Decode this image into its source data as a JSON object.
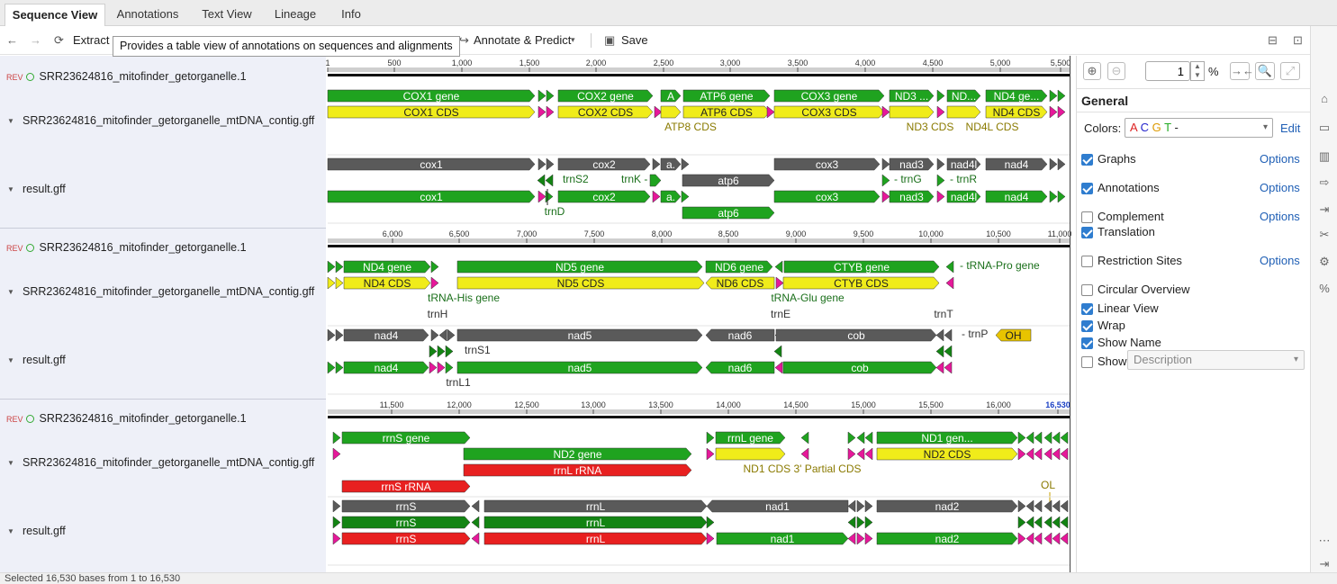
{
  "tabs": [
    "Sequence View",
    "Annotations",
    "Text View",
    "Lineage",
    "Info"
  ],
  "toolbar": {
    "extract": "Extract",
    "annotate": "Annotate & Predict",
    "save": "Save",
    "tooltip": "Provides a table view of annotations on sequences and alignments"
  },
  "rows": [
    {
      "seq": "SRR23624816_mitofinder_getorganelle.1",
      "gff": "SRR23624816_mitofinder_getorganelle_mtDNA_contig.gff",
      "result": "result.gff",
      "rev": "REV"
    },
    {
      "seq": "SRR23624816_mitofinder_getorganelle.1",
      "gff": "SRR23624816_mitofinder_getorganelle_mtDNA_contig.gff",
      "result": "result.gff",
      "rev": "REV"
    },
    {
      "seq": "SRR23624816_mitofinder_getorganelle.1",
      "gff": "SRR23624816_mitofinder_getorganelle_mtDNA_contig.gff",
      "result": "result.gff",
      "rev": "REV"
    }
  ],
  "ruler1": [
    "1",
    "500",
    "1,000",
    "1,500",
    "2,000",
    "2,500",
    "3,000",
    "3,500",
    "4,000",
    "4,500",
    "5,000",
    "5,500"
  ],
  "ruler2": [
    "6,000",
    "6,500",
    "7,000",
    "7,500",
    "8,000",
    "8,500",
    "9,000",
    "9,500",
    "10,000",
    "10,500",
    "11,000"
  ],
  "ruler3": [
    "11,500",
    "12,000",
    "12,500",
    "13,000",
    "13,500",
    "14,000",
    "14,500",
    "15,000",
    "15,500",
    "16,000",
    "16,530"
  ],
  "features": [
    {
      "label": "COX1 gene",
      "color": "#1fa31f"
    },
    {
      "label": "COX2 gene",
      "color": "#1fa31f"
    },
    {
      "label": "A",
      "color": "#1fa31f"
    },
    {
      "label": "ATP6 gene",
      "color": "#1fa31f"
    },
    {
      "label": "COX3 gene",
      "color": "#1fa31f"
    },
    {
      "label": "ND3 ...",
      "color": "#1fa31f"
    },
    {
      "label": "ND...",
      "color": "#1fa31f"
    },
    {
      "label": "ND4 ge...",
      "color": "#1fa31f"
    },
    {
      "label": "COX1 CDS",
      "color": "#f0ec1a"
    },
    {
      "label": "COX2 CDS",
      "color": "#f0ec1a"
    },
    {
      "label": "ATP6 CDS",
      "color": "#f0ec1a"
    },
    {
      "label": "COX3 CDS",
      "color": "#f0ec1a"
    },
    {
      "label": "ND4 CDS",
      "color": "#f0ec1a"
    },
    {
      "label": "cox1",
      "color": "#5a5a5a"
    },
    {
      "label": "cox2",
      "color": "#5a5a5a"
    },
    {
      "label": "a.",
      "color": "#5a5a5a"
    },
    {
      "label": "cox3",
      "color": "#5a5a5a"
    },
    {
      "label": "nad3",
      "color": "#5a5a5a"
    },
    {
      "label": "nad4l",
      "color": "#5a5a5a"
    },
    {
      "label": "nad4",
      "color": "#5a5a5a"
    },
    {
      "label": "atp6",
      "color": "#5a5a5a"
    },
    {
      "label": "cox1",
      "color": "#1fa31f"
    },
    {
      "label": "cox2",
      "color": "#1fa31f"
    },
    {
      "label": "a.",
      "color": "#1fa31f"
    },
    {
      "label": "cox3",
      "color": "#1fa31f"
    },
    {
      "label": "nad3",
      "color": "#1fa31f"
    },
    {
      "label": "nad4l",
      "color": "#1fa31f"
    },
    {
      "label": "nad4",
      "color": "#1fa31f"
    },
    {
      "label": "atp6",
      "color": "#1fa31f"
    },
    {
      "label": "ND4 gene",
      "color": "#1fa31f"
    },
    {
      "label": "ND5 gene",
      "color": "#1fa31f"
    },
    {
      "label": "ND6 gene",
      "color": "#1fa31f"
    },
    {
      "label": "CTYB gene",
      "color": "#1fa31f"
    },
    {
      "label": "ND4 CDS",
      "color": "#f0ec1a"
    },
    {
      "label": "ND5 CDS",
      "color": "#f0ec1a"
    },
    {
      "label": "ND6 CDS",
      "color": "#f0ec1a"
    },
    {
      "label": "CTYB CDS",
      "color": "#f0ec1a"
    },
    {
      "label": "nad4",
      "color": "#5a5a5a"
    },
    {
      "label": "nad5",
      "color": "#5a5a5a"
    },
    {
      "label": "nad6",
      "color": "#5a5a5a"
    },
    {
      "label": "cob",
      "color": "#5a5a5a"
    },
    {
      "label": "OH",
      "color": "#e8c400"
    },
    {
      "label": "nad4",
      "color": "#1fa31f"
    },
    {
      "label": "nad5",
      "color": "#1fa31f"
    },
    {
      "label": "nad6",
      "color": "#1fa31f"
    },
    {
      "label": "cob",
      "color": "#1fa31f"
    },
    {
      "label": "rrnS gene",
      "color": "#1fa31f"
    },
    {
      "label": "rrnL gene",
      "color": "#1fa31f"
    },
    {
      "label": "ND1 gen...",
      "color": "#1fa31f"
    },
    {
      "label": "ND2 gene",
      "color": "#1fa31f"
    },
    {
      "label": "rrnL rRNA",
      "color": "#e82020"
    },
    {
      "label": "ND2 CDS",
      "color": "#f0ec1a"
    },
    {
      "label": "rrnS rRNA",
      "color": "#e82020"
    },
    {
      "label": "rrnS",
      "color": "#5a5a5a"
    },
    {
      "label": "rrnL",
      "color": "#5a5a5a"
    },
    {
      "label": "nad1",
      "color": "#5a5a5a"
    },
    {
      "label": "nad2",
      "color": "#5a5a5a"
    },
    {
      "label": "rrnS",
      "color": "#138413"
    },
    {
      "label": "rrnL",
      "color": "#138413"
    },
    {
      "label": "rrnS",
      "color": "#e82020"
    },
    {
      "label": "rrnL",
      "color": "#e82020"
    },
    {
      "label": "nad1",
      "color": "#1fa31f"
    },
    {
      "label": "nad2",
      "color": "#1fa31f"
    }
  ],
  "labels": {
    "atp8": "ATP8 CDS",
    "nd3": "ND3 CDS",
    "nd4l": "ND4L CDS",
    "trnS2": "trnS2",
    "trnK": "trnK",
    "trnD": "trnD",
    "trnG": "trnG",
    "trnR": "trnR",
    "trnHisGene": "tRNA-His gene",
    "trnGluGene": "tRNA-Glu gene",
    "trnProGene": "tRNA-Pro gene",
    "trnH": "trnH",
    "trnE": "trnE",
    "trnT": "trnT",
    "trnP": "trnP",
    "trnS1": "trnS1",
    "trnL1": "trnL1",
    "nd1partial": "ND1 CDS 3' Partial CDS",
    "ol": "OL"
  },
  "panel": {
    "title": "General",
    "colors_label": "Colors:",
    "colors_value": "A C G T -",
    "edit": "Edit",
    "zoom_value": "1",
    "zoom_unit": "%",
    "items": [
      {
        "label": "Graphs",
        "checked": true,
        "options": "Options"
      },
      {
        "label": "Annotations",
        "checked": true,
        "options": "Options"
      },
      {
        "label": "Complement",
        "checked": false,
        "options": "Options"
      },
      {
        "label": "Translation",
        "checked": true,
        "options": ""
      },
      {
        "label": "Restriction Sites",
        "checked": false,
        "options": "Options"
      },
      {
        "label": "Circular Overview",
        "checked": false,
        "options": ""
      },
      {
        "label": "Linear View",
        "checked": true,
        "options": ""
      },
      {
        "label": "Wrap",
        "checked": true,
        "options": ""
      },
      {
        "label": "Show Name",
        "checked": true,
        "options": ""
      },
      {
        "label": "Show",
        "checked": false,
        "options": ""
      }
    ],
    "show_select": "Description"
  },
  "status": "Selected 16,530 bases from 1 to 16,530"
}
